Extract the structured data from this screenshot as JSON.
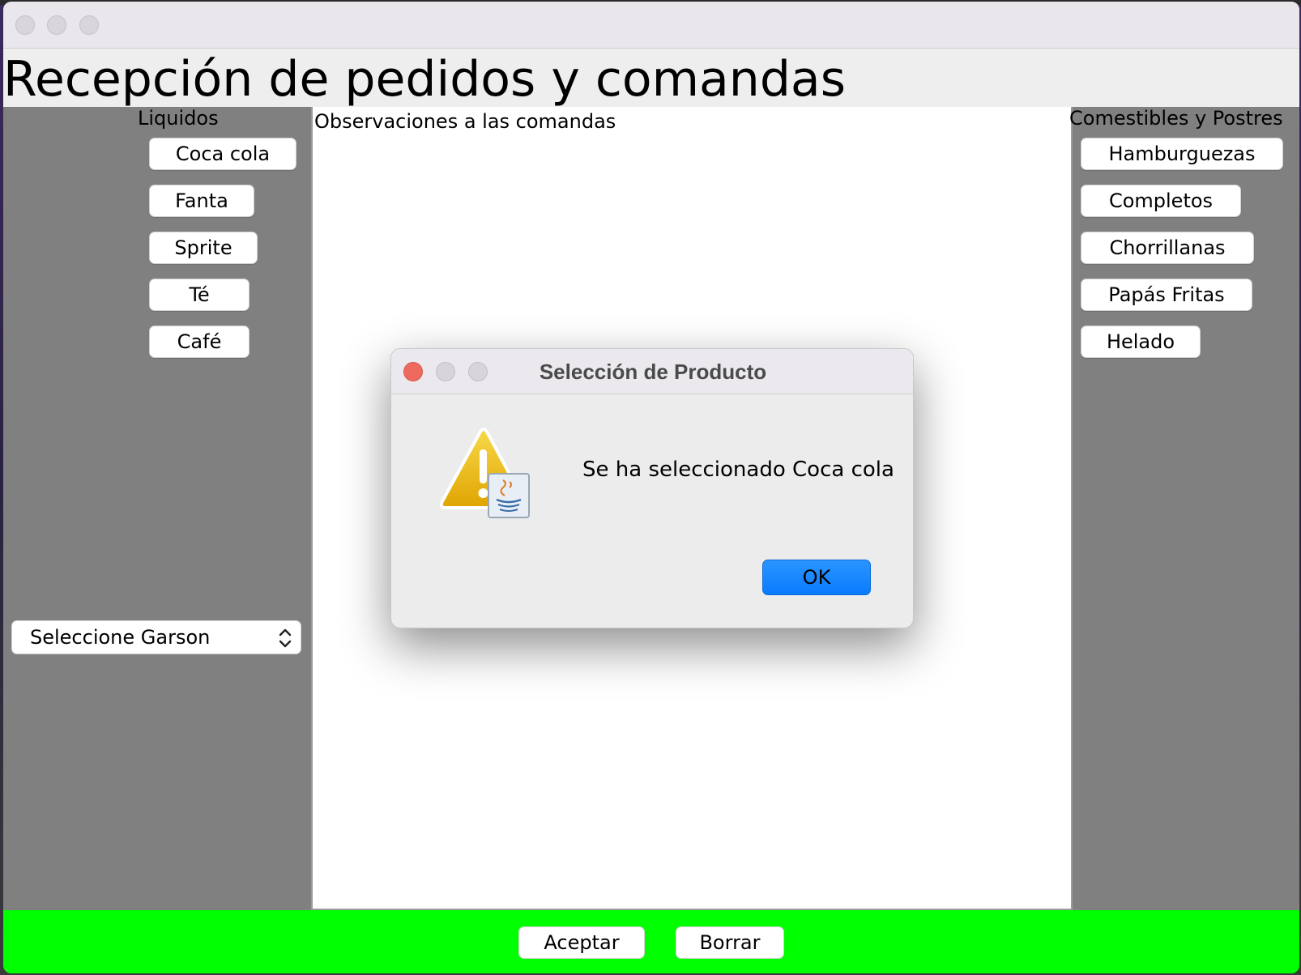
{
  "app": {
    "header_title": "Recepción de pedidos y comandas"
  },
  "left_panel": {
    "title": "Liquidos",
    "buttons": [
      "Coca cola",
      "Fanta",
      "Sprite",
      "Té",
      "Café"
    ],
    "combo": {
      "value": "Seleccione Garson"
    }
  },
  "center": {
    "label": "Observaciones a las comandas"
  },
  "right_panel": {
    "title": "Comestibles y Postres",
    "buttons": [
      "Hamburguezas",
      "Completos",
      "Chorrillanas",
      "Papás Fritas",
      "Helado"
    ]
  },
  "bottom": {
    "accept": "Aceptar",
    "clear": "Borrar"
  },
  "dialog": {
    "title": "Selección de Producto",
    "message": "Se ha seleccionado Coca cola",
    "ok": "OK",
    "icon": "warning-icon"
  },
  "colors": {
    "panel": "#808080",
    "bottom_bar": "#00ff00",
    "ok_button": "#0a7bff"
  }
}
